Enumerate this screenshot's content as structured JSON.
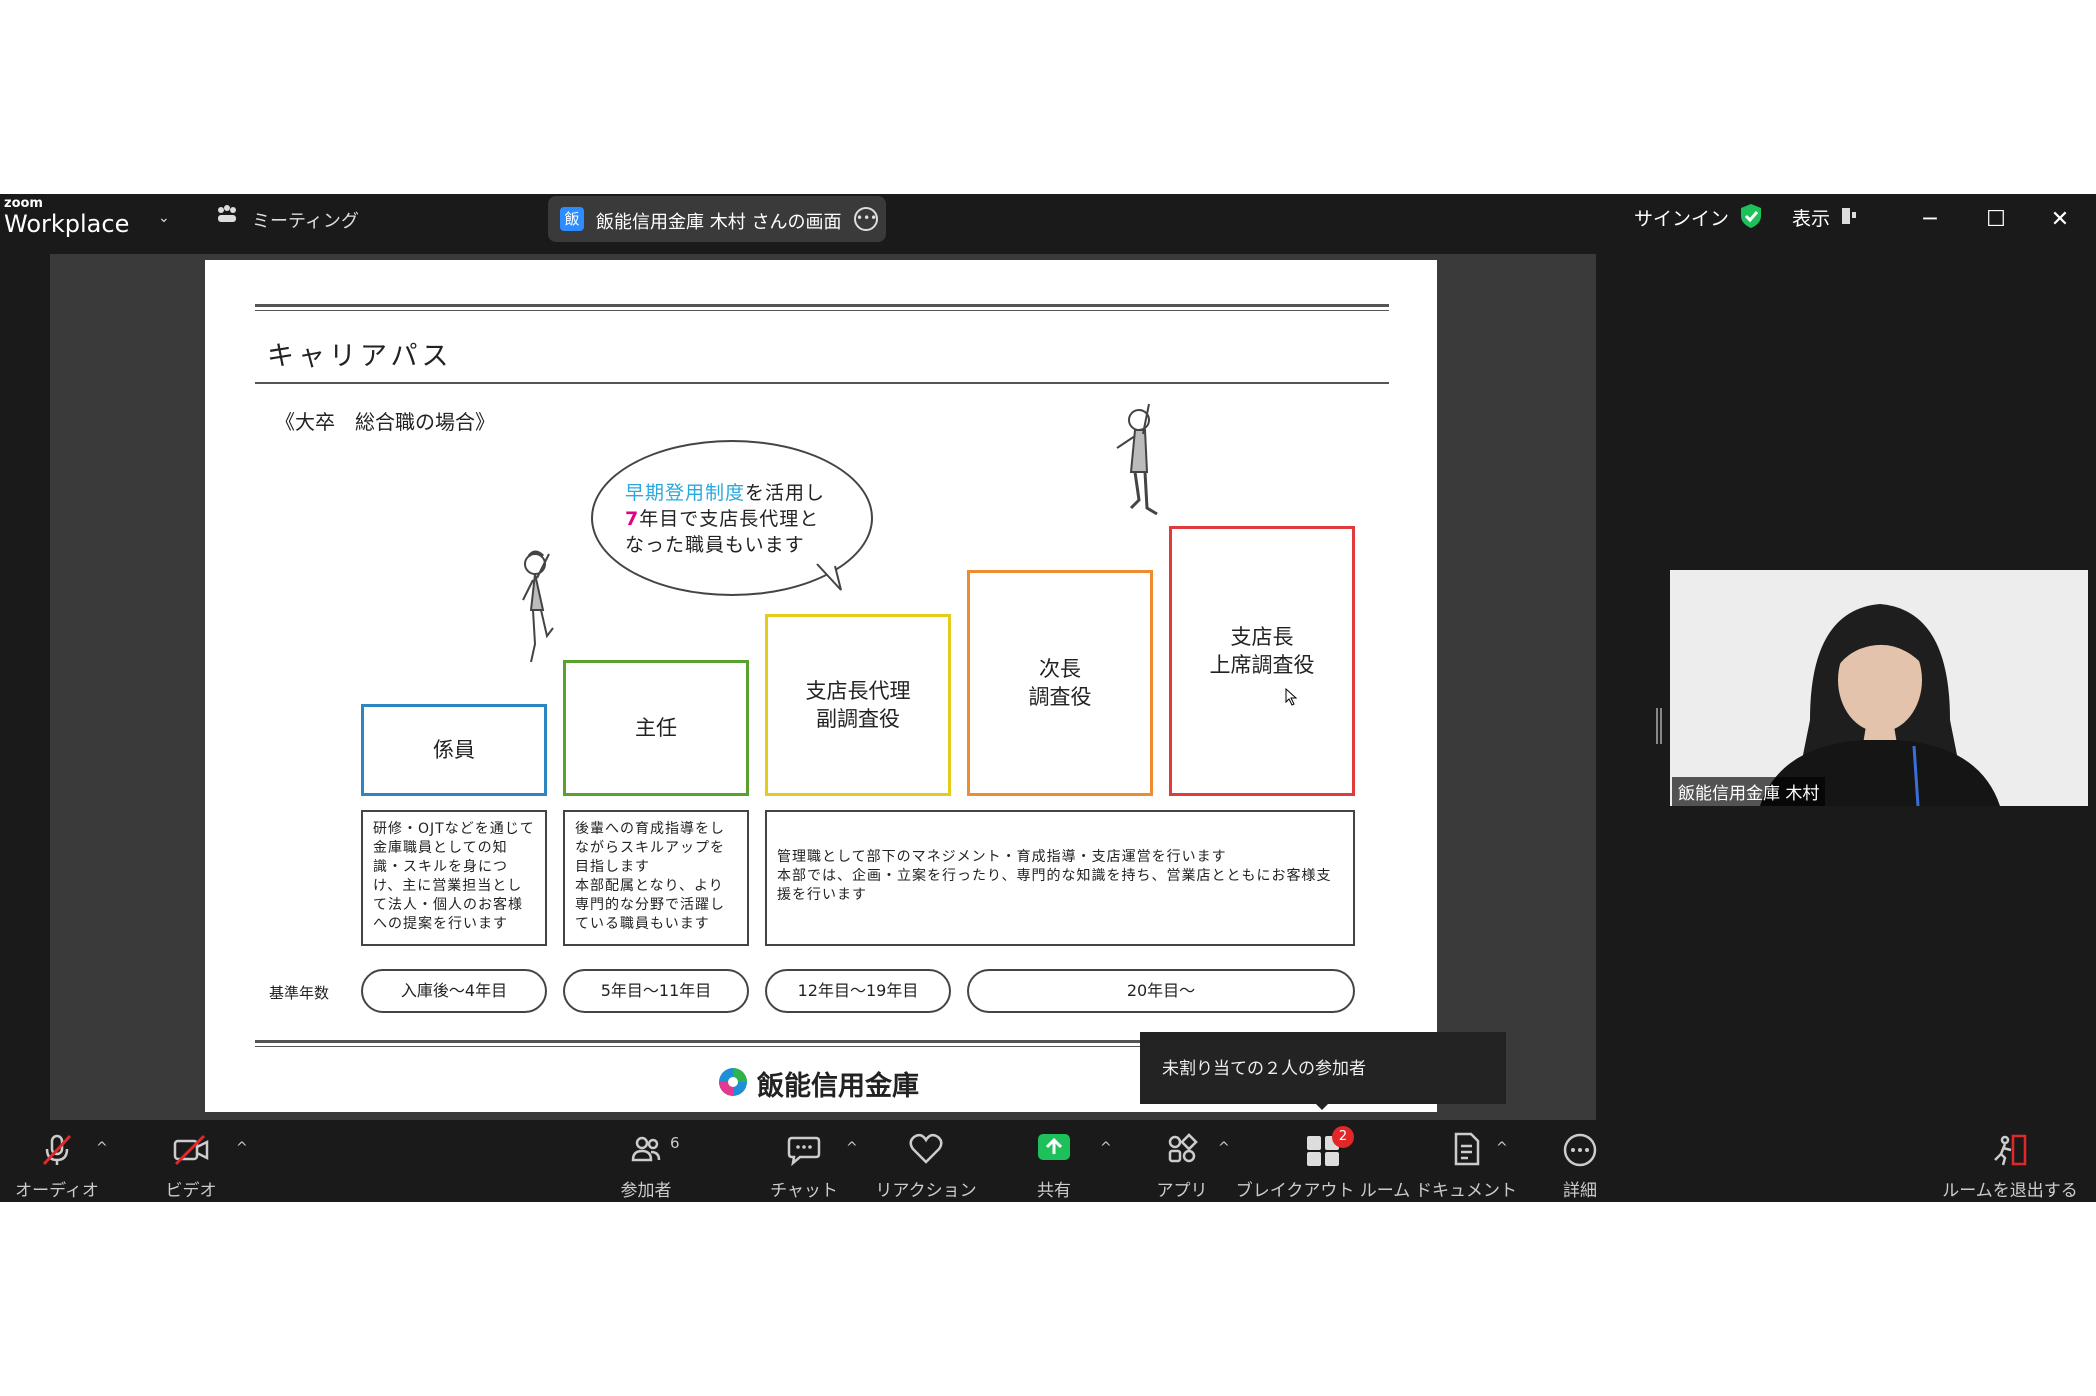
{
  "topbar": {
    "brand_small": "zoom",
    "brand": "Workplace",
    "meeting_label": "ミーティング",
    "share_badge": "飯",
    "share_title": "飯能信用金庫 木村 さんの画面",
    "signin": "サインイン",
    "view": "表示"
  },
  "slide": {
    "title": "キャリアパス",
    "subtitle": "《大卒　総合職の場合》",
    "bubble": {
      "line1_highlight": "早期登用制度",
      "line1_rest": "を活用し",
      "line2_num": "7",
      "line2_rest": "年目で支店長代理と",
      "line3": "なった職員もいます"
    },
    "steps": [
      {
        "line1": "係員",
        "line2": "",
        "color": "#2e86c1"
      },
      {
        "line1": "主任",
        "line2": "",
        "color": "#5aa02c"
      },
      {
        "line1": "支店長代理",
        "line2": "副調査役",
        "color": "#e6cc1a"
      },
      {
        "line1": "次長",
        "line2": "調査役",
        "color": "#f08c30"
      },
      {
        "line1": "支店長",
        "line2": "上席調査役",
        "color": "#e03a3a"
      }
    ],
    "descriptions": [
      "研修・OJTなどを通じて金庫職員としての知識・スキルを身につけ、主に営業担当として法人・個人のお客様への提案を行います",
      "後輩への育成指導をしながらスキルアップを目指します\n本部配属となり、より専門的な分野で活躍している職員もいます",
      "管理職として部下のマネジメント・育成指導・支店運営を行います\n本部では、企画・立案を行ったり、専門的な知識を持ち、営業店とともにお客様支援を行います"
    ],
    "base_label": "基準年数",
    "years": [
      "入庫後～4年目",
      "5年目～11年目",
      "12年目～19年目",
      "20年目～"
    ],
    "footer": "飯能信用金庫"
  },
  "tooltip": "未割り当ての２人の参加者",
  "video": {
    "name": "飯能信用金庫 木村"
  },
  "toolbar": {
    "audio": "オーディオ",
    "video": "ビデオ",
    "participants": "参加者",
    "participants_count": "6",
    "chat": "チャット",
    "reactions": "リアクション",
    "share": "共有",
    "apps": "アプリ",
    "breakout": "ブレイクアウト ルーム",
    "breakout_badge": "2",
    "docs": "ドキュメント",
    "more": "詳細",
    "leave": "ルームを退出する"
  },
  "colors": {
    "accent": "#2d8cff",
    "share_green": "#1ec05a",
    "danger": "#e02828"
  }
}
